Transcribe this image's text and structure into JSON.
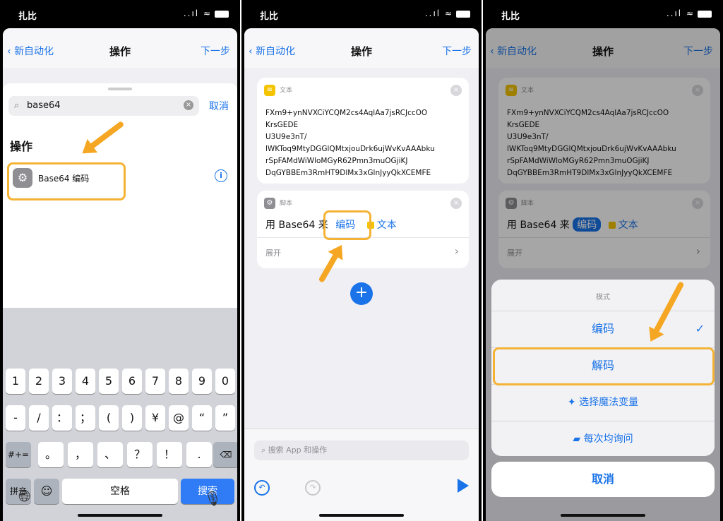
{
  "status": {
    "carrier": "扎比",
    "icons": "..ıl ≈"
  },
  "nav": {
    "back": "新自动化",
    "title": "操作",
    "next": "下一步"
  },
  "panel1": {
    "search_value": "base64",
    "cancel": "取消",
    "section": "操作",
    "result_label": "Base64 编码",
    "info": "i",
    "keyboard": {
      "row1": [
        "1",
        "2",
        "3",
        "4",
        "5",
        "6",
        "7",
        "8",
        "9",
        "0"
      ],
      "row2": [
        "-",
        "/",
        "：",
        "；",
        "(",
        ")",
        "¥",
        "@",
        "“",
        "”"
      ],
      "row3_left": "#+=",
      "row3": [
        "。",
        "，",
        "、",
        "？",
        "！",
        "."
      ],
      "pinyin": "拼音",
      "emoji": "☺",
      "space": "空格",
      "search": "搜索"
    }
  },
  "panel2": {
    "text_card": {
      "header": "文本",
      "lines": [
        "FXm9+ynNVXCiYCQM2cs4AqlAa7jsRCJccOO",
        "KrsGEDE",
        "U3U9e3nT/",
        "lWKToq9MtyDGGlQMtxjouDrk6ujWvKvAAAbku",
        "rSpFAMdWiWloMGyR62Pmn3muOGjiKJ",
        "DqGYBBEm3RmHT9DlMx3xGlnJyyQkXCEMFE"
      ]
    },
    "script_card": {
      "header": "脚本",
      "prefix": "用 Base64 来",
      "mode": "编码",
      "variable": "文本",
      "expand": "展开"
    },
    "search_placeholder": "搜索 App 和操作"
  },
  "panel3": {
    "menu_title": "模式",
    "options": [
      "编码",
      "解码"
    ],
    "selected": "编码",
    "magic": "选择魔法变量",
    "ask": "每次均询问",
    "cancel": "取消"
  },
  "colors": {
    "accent": "#1a73e8",
    "highlight": "#f5b335",
    "arrow": "#f5a623"
  }
}
